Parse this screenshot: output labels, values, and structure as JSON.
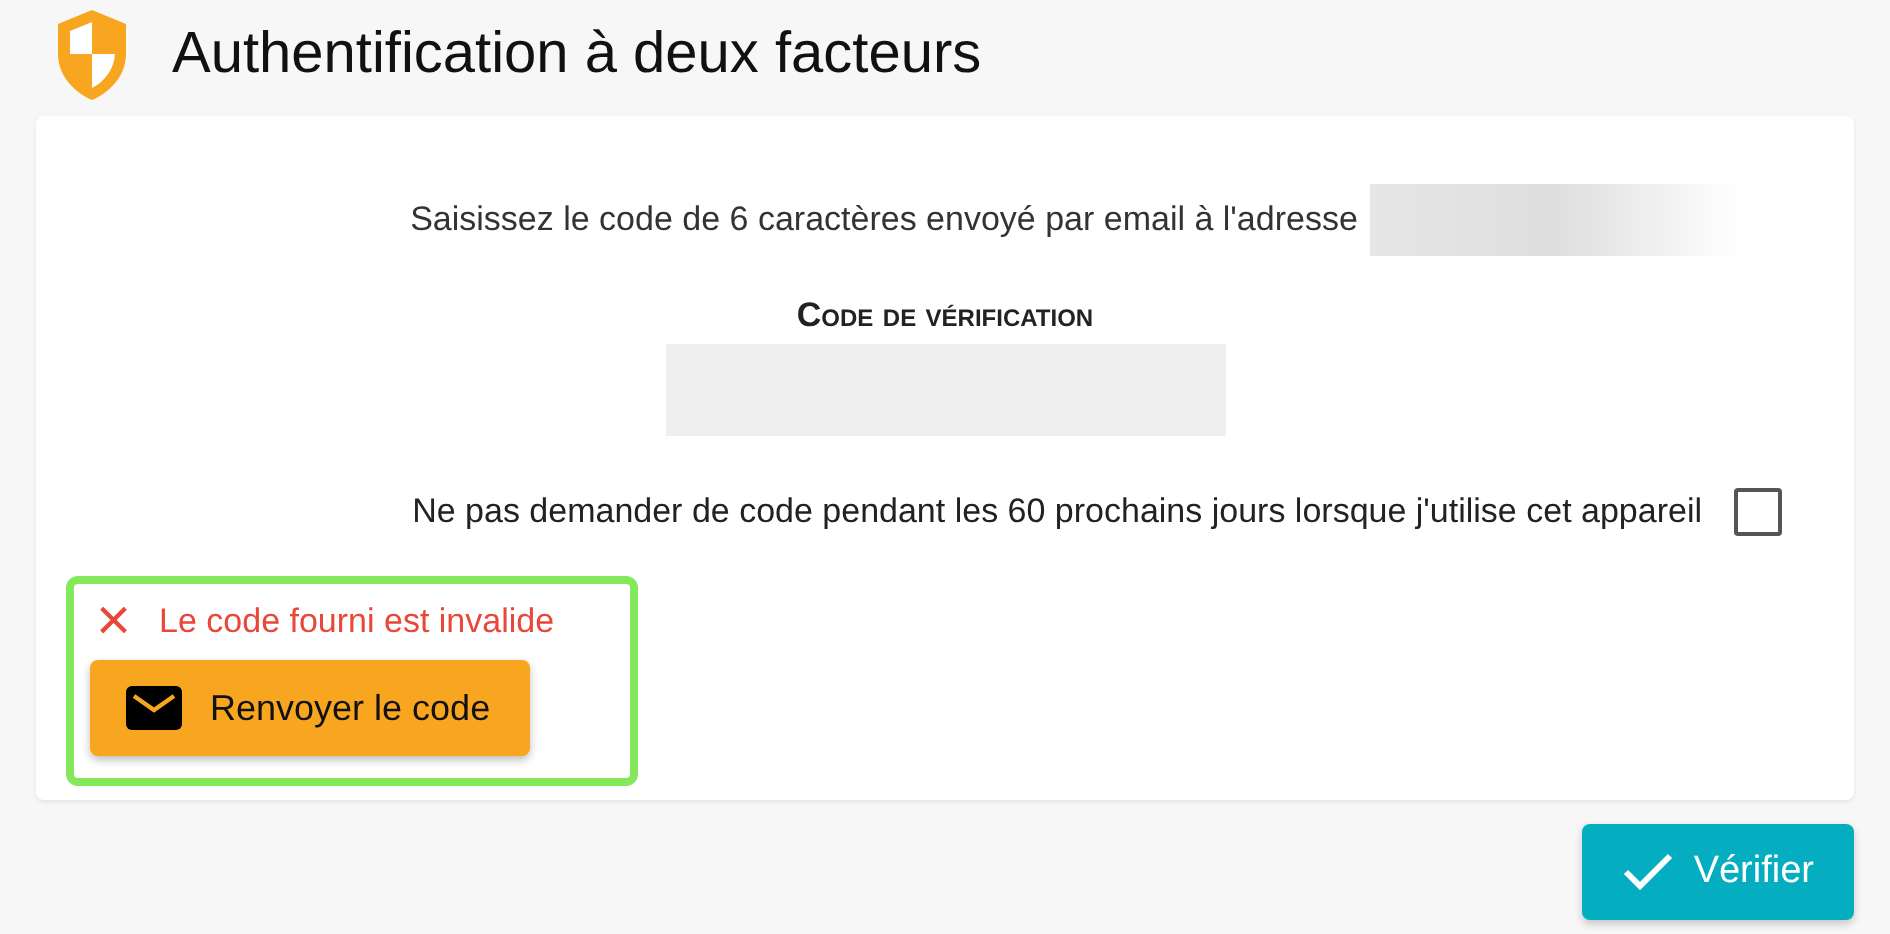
{
  "header": {
    "title": "Authentification à deux facteurs"
  },
  "form": {
    "instruction": "Saisissez le code de 6 caractères envoyé par email à l'adresse",
    "code_label": "Code de vérification",
    "remember": {
      "label": "Ne pas demander de code pendant les 60 prochains jours lorsque j'utilise cet appareil",
      "checked": false
    }
  },
  "error": {
    "icon": "×",
    "message": "Le code fourni est invalide",
    "resend_button": "Renvoyer le code"
  },
  "verify_button": "Vérifier"
}
